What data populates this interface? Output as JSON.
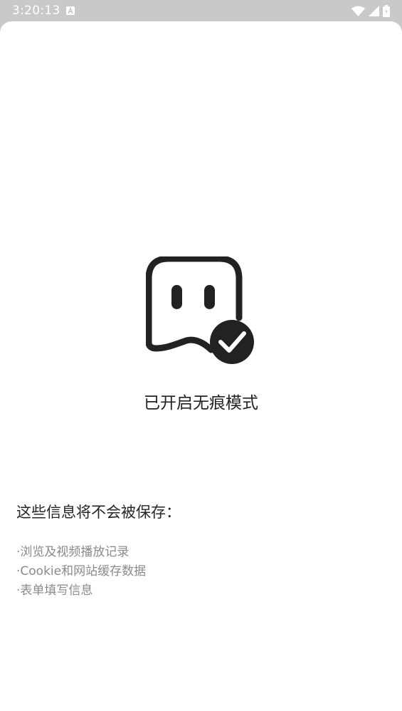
{
  "status_bar": {
    "time": "3:20:13",
    "icons": [
      "notification-a-icon",
      "wifi-icon",
      "signal-icon",
      "battery-icon"
    ]
  },
  "incognito": {
    "icon": "incognito-ghost-check-icon",
    "title": "已开启无痕模式"
  },
  "info": {
    "heading": "这些信息将不会被保存：",
    "items": [
      "·浏览及视频播放记录",
      "·Cookie和网站缓存数据",
      "·表单填写信息"
    ]
  },
  "colors": {
    "icon": "#222222",
    "title": "#222222",
    "heading": "#262626",
    "item_text": "#8a8a8a",
    "status_bar_bg": "#c9c9c9"
  }
}
